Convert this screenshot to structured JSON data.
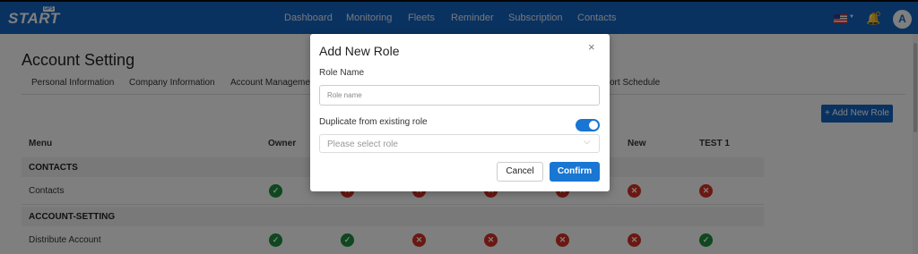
{
  "header": {
    "logo": "START",
    "logo_badge": "GPS",
    "nav": [
      "Dashboard",
      "Monitoring",
      "Fleets",
      "Reminder",
      "Subscription",
      "Contacts"
    ],
    "avatar_letter": "A"
  },
  "page": {
    "title": "Account Setting",
    "subnav": [
      "Personal Information",
      "Company Information",
      "Account Management",
      "ort Schedule"
    ],
    "add_role_label": "+ Add New Role"
  },
  "table": {
    "headers": [
      "Menu",
      "Owner",
      "New",
      "TEST 1"
    ],
    "sections": [
      {
        "name": "CONTACTS",
        "row": "Contacts",
        "status": [
          "ok",
          "no",
          "no",
          "no",
          "no",
          "no",
          "no"
        ]
      },
      {
        "name": "ACCOUNT-SETTING",
        "row": "Distribute Account",
        "status": [
          "ok",
          "ok",
          "no",
          "no",
          "no",
          "no",
          "ok"
        ]
      }
    ]
  },
  "modal": {
    "title": "Add New Role",
    "close": "×",
    "role_name_label": "Role Name",
    "role_name_placeholder": "Role name",
    "duplicate_label": "Duplicate from existing role",
    "duplicate_enabled": true,
    "select_placeholder": "Please select role",
    "cancel_label": "Cancel",
    "confirm_label": "Confirm"
  },
  "icons": {
    "ok": "check-circle-icon",
    "no": "x-circle-icon"
  },
  "colors": {
    "primary": "#1565c0",
    "ok": "#1e8e3e",
    "no": "#d93025"
  }
}
